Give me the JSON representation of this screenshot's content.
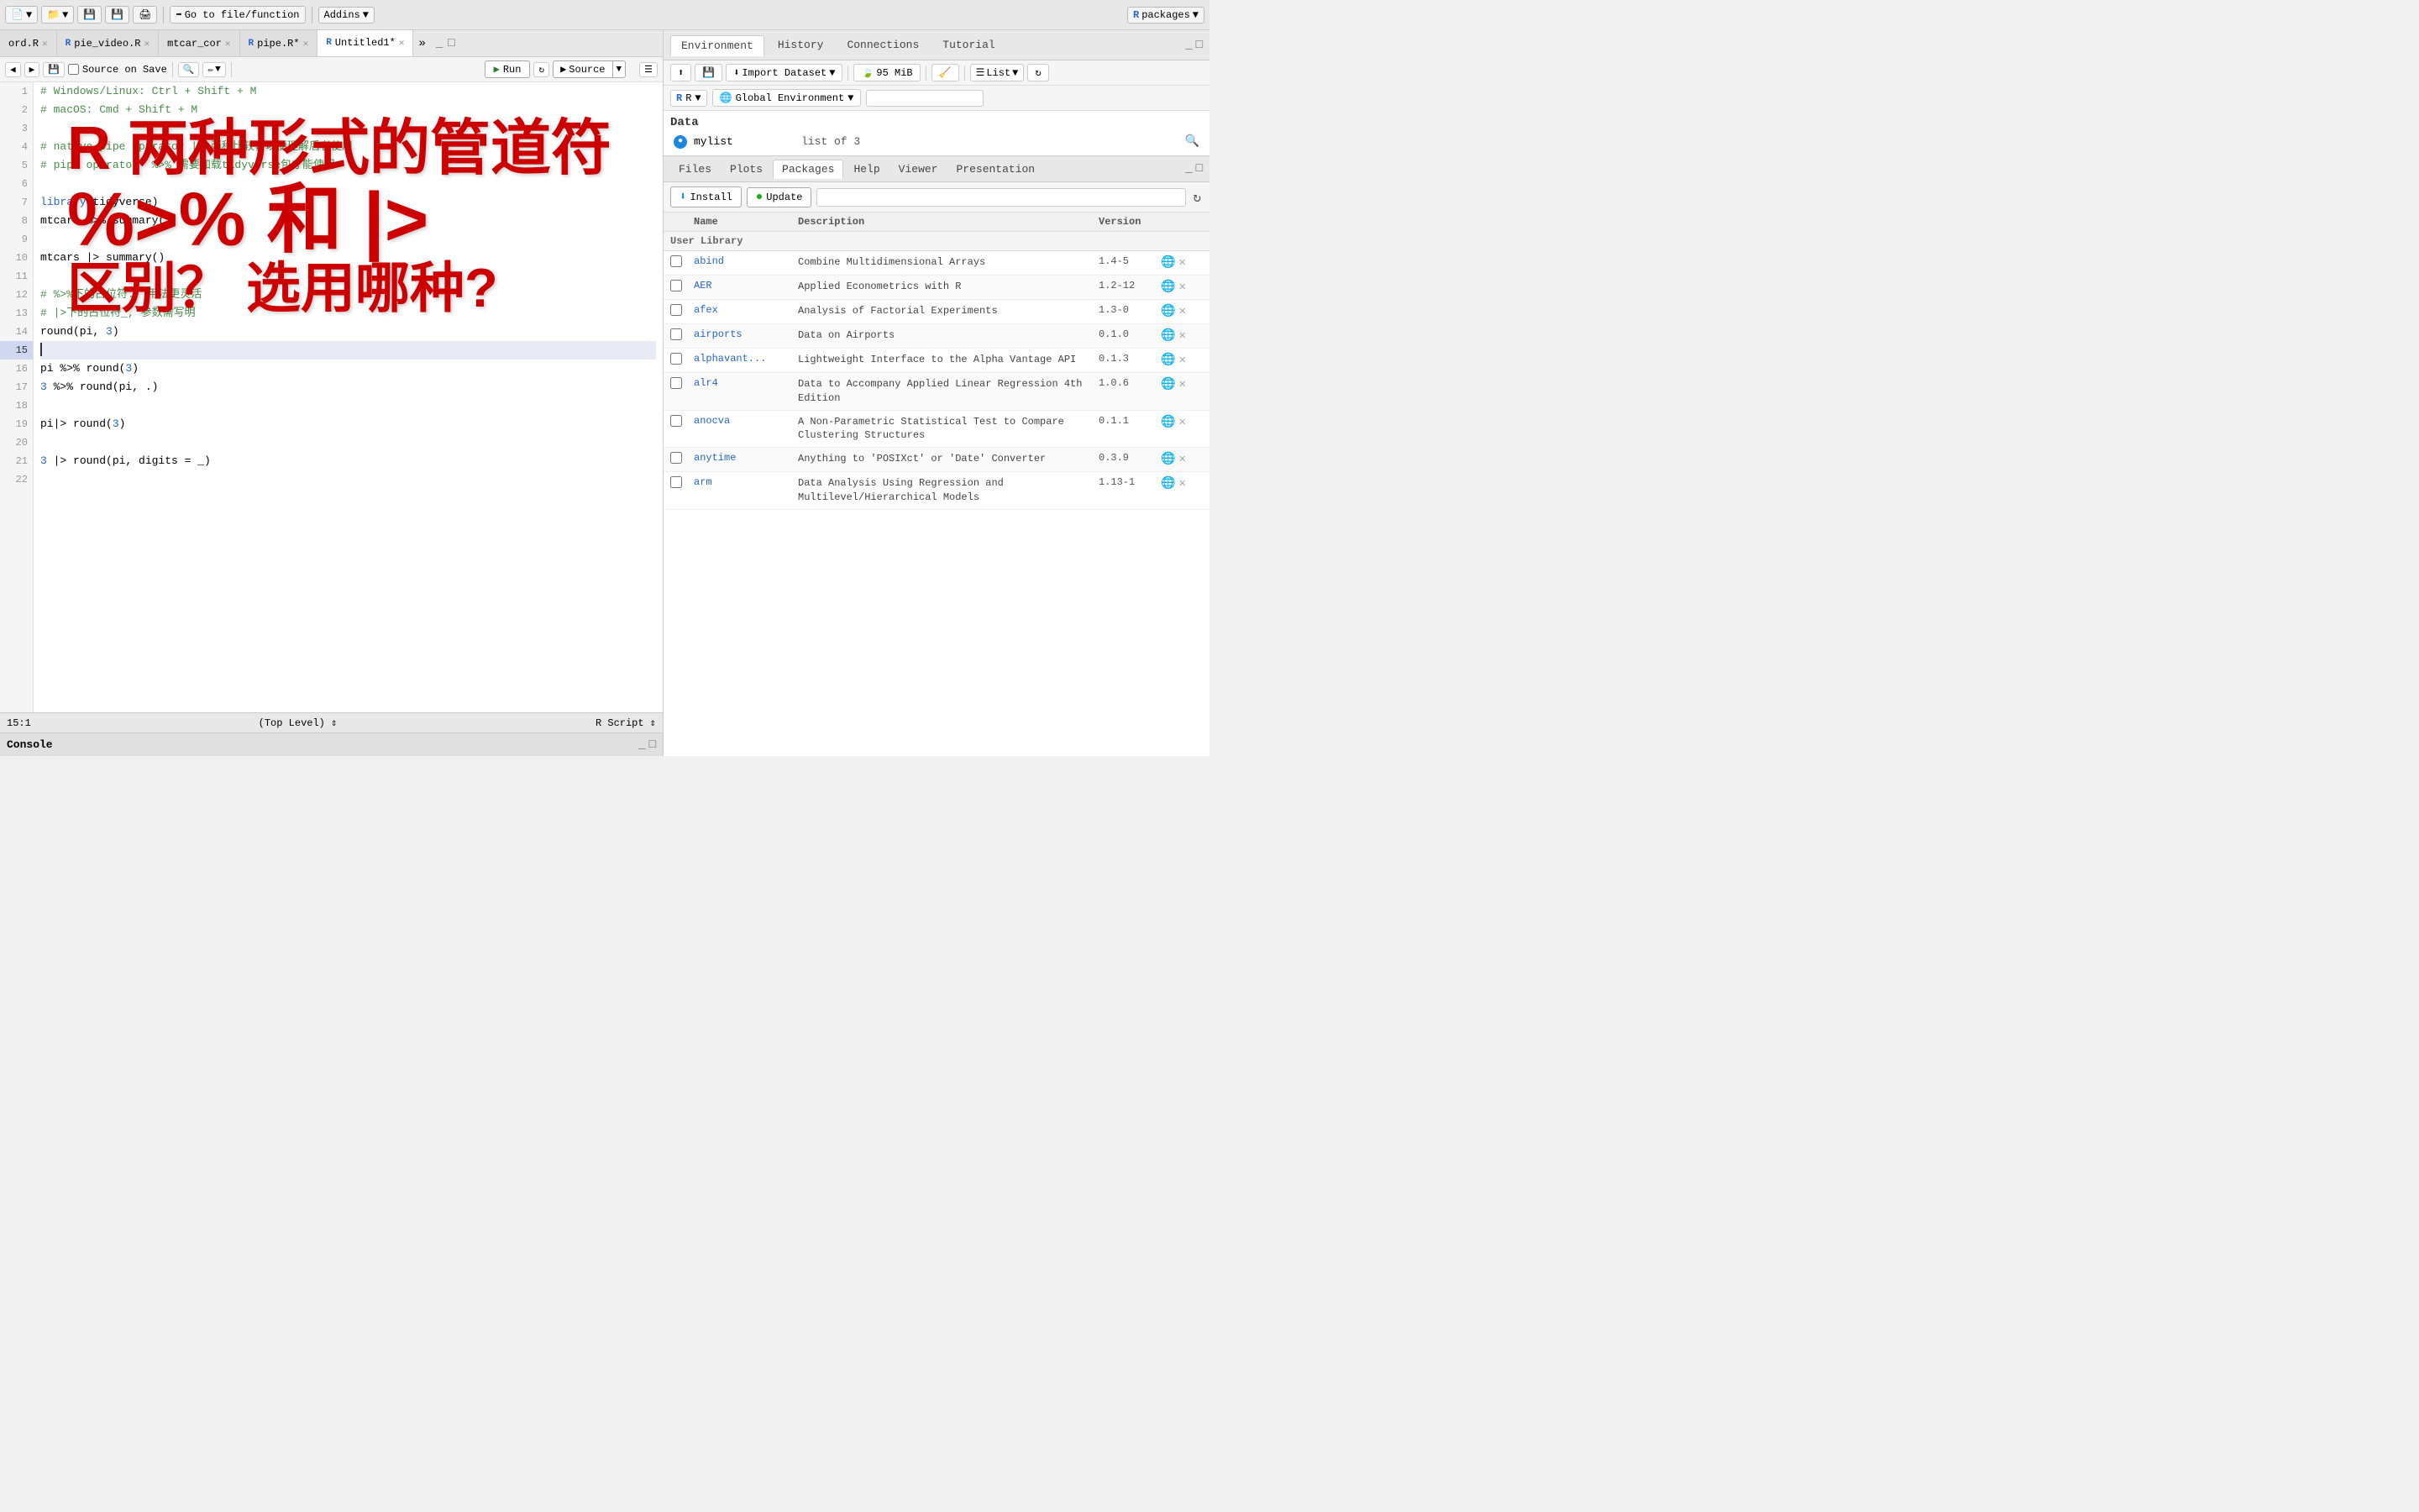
{
  "topToolbar": {
    "newFileLabel": "New File",
    "openLabel": "Open",
    "saveLabel": "Save",
    "saveAllLabel": "Save All",
    "printLabel": "Print",
    "goToLabel": "Go to file/function",
    "addinsLabel": "Addins",
    "packagesLabel": "packages"
  },
  "editorTabs": [
    {
      "id": "tab-ord",
      "label": "ord.R",
      "modified": false,
      "hasR": false
    },
    {
      "id": "tab-pie-video",
      "label": "pie_video.R",
      "modified": false,
      "hasR": true
    },
    {
      "id": "tab-mtcar",
      "label": "mtcar_cor",
      "modified": false,
      "hasR": false
    },
    {
      "id": "tab-pipe",
      "label": "pipe.R",
      "modified": true,
      "hasR": true,
      "active": false
    },
    {
      "id": "tab-untitled",
      "label": "Untitled1",
      "modified": true,
      "hasR": true,
      "active": true
    }
  ],
  "editorToolbar": {
    "sourceOnSave": "Source on Save",
    "runLabel": "Run",
    "rerunLabel": "Re-run",
    "sourceLabel": "Source"
  },
  "codeLines": [
    {
      "num": 1,
      "text": "# Windows/Linux: Ctrl + Shift + M",
      "type": "comment"
    },
    {
      "num": 2,
      "text": "# macOS: Cmd + Shift + M",
      "type": "comment"
    },
    {
      "num": 3,
      "text": "",
      "type": "blank"
    },
    {
      "num": 4,
      "text": "# native pipe operator |> 两种比较，以便理解后者使用",
      "type": "comment"
    },
    {
      "num": 5,
      "text": "# pipe operator  %>% 需要加载tidyverse包才能使用",
      "type": "comment"
    },
    {
      "num": 6,
      "text": "",
      "type": "blank"
    },
    {
      "num": 7,
      "text": "library(tidyverse)",
      "type": "code"
    },
    {
      "num": 8,
      "text": "mtcars %>% summary()",
      "type": "code"
    },
    {
      "num": 9,
      "text": "",
      "type": "blank"
    },
    {
      "num": 10,
      "text": "mtcars |> summary()",
      "type": "code"
    },
    {
      "num": 11,
      "text": "",
      "type": "blank"
    },
    {
      "num": 12,
      "text": "# %>%下的占位符., 用法更灵活",
      "type": "comment"
    },
    {
      "num": 13,
      "text": "# |>下的占位符_, 参数需写明",
      "type": "comment"
    },
    {
      "num": 14,
      "text": "round(pi, 3)",
      "type": "code"
    },
    {
      "num": 15,
      "text": "",
      "type": "current"
    },
    {
      "num": 16,
      "text": "pi %>% round(3)",
      "type": "code"
    },
    {
      "num": 17,
      "text": "3 %>% round(pi, .)",
      "type": "code"
    },
    {
      "num": 18,
      "text": "",
      "type": "blank"
    },
    {
      "num": 19,
      "text": "pi|> round(3)",
      "type": "code"
    },
    {
      "num": 20,
      "text": "",
      "type": "blank"
    },
    {
      "num": 21,
      "text": "3 |> round(pi, digits = _)",
      "type": "code"
    },
    {
      "num": 22,
      "text": "",
      "type": "blank"
    }
  ],
  "annotation": {
    "title": "R 两种形式的管道符",
    "subtitle": "%>% 和 |>",
    "question": "区别？ 选用哪种?"
  },
  "statusBar": {
    "position": "15:1",
    "level": "(Top Level)",
    "scriptType": "R Script"
  },
  "console": {
    "label": "Console"
  },
  "rightPanel": {
    "tabs": [
      {
        "id": "tab-environment",
        "label": "Environment",
        "active": true
      },
      {
        "id": "tab-history",
        "label": "History",
        "active": false
      },
      {
        "id": "tab-connections",
        "label": "Connections",
        "active": false
      },
      {
        "id": "tab-tutorial",
        "label": "Tutorial",
        "active": false
      }
    ],
    "toolbar": {
      "importDataset": "Import Dataset",
      "memory": "95 MiB",
      "listLabel": "List",
      "rLabel": "R",
      "globalEnv": "Global Environment"
    },
    "dataSection": {
      "header": "Data",
      "items": [
        {
          "name": "mylist",
          "type": "list of  3"
        }
      ]
    }
  },
  "bottomPanel": {
    "tabs": [
      {
        "id": "tab-files",
        "label": "Files",
        "active": false
      },
      {
        "id": "tab-plots",
        "label": "Plots",
        "active": false
      },
      {
        "id": "tab-packages",
        "label": "Packages",
        "active": true
      },
      {
        "id": "tab-help",
        "label": "Help",
        "active": false
      },
      {
        "id": "tab-viewer",
        "label": "Viewer",
        "active": false
      },
      {
        "id": "tab-presentation",
        "label": "Presentation",
        "active": false
      }
    ],
    "packageToolbar": {
      "installLabel": "Install",
      "updateLabel": "Update",
      "searchPlaceholder": ""
    },
    "tableHeaders": {
      "name": "Name",
      "description": "Description",
      "version": "Version"
    },
    "userLibraryLabel": "User Library",
    "packages": [
      {
        "name": "abind",
        "desc": "Combine Multidimensional Arrays",
        "version": "1.4-5",
        "checked": false
      },
      {
        "name": "AER",
        "desc": "Applied Econometrics with R",
        "version": "1.2-12",
        "checked": false
      },
      {
        "name": "afex",
        "desc": "Analysis of Factorial Experiments",
        "version": "1.3-0",
        "checked": false
      },
      {
        "name": "airports",
        "desc": "Data on Airports",
        "version": "0.1.0",
        "checked": false
      },
      {
        "name": "alphavant...",
        "desc": "Lightweight Interface to the Alpha Vantage API",
        "version": "0.1.3",
        "checked": false
      },
      {
        "name": "alr4",
        "desc": "Data to Accompany Applied Linear Regression 4th Edition",
        "version": "1.0.6",
        "checked": false
      },
      {
        "name": "anocva",
        "desc": "A Non-Parametric Statistical Test to Compare Clustering Structures",
        "version": "0.1.1",
        "checked": false
      },
      {
        "name": "anytime",
        "desc": "Anything to 'POSIXct' or 'Date' Converter",
        "version": "0.3.9",
        "checked": false
      },
      {
        "name": "arm",
        "desc": "Data Analysis Using Regression and Multilevel/Hierarchical Models",
        "version": "1.13-1",
        "checked": false
      }
    ]
  }
}
